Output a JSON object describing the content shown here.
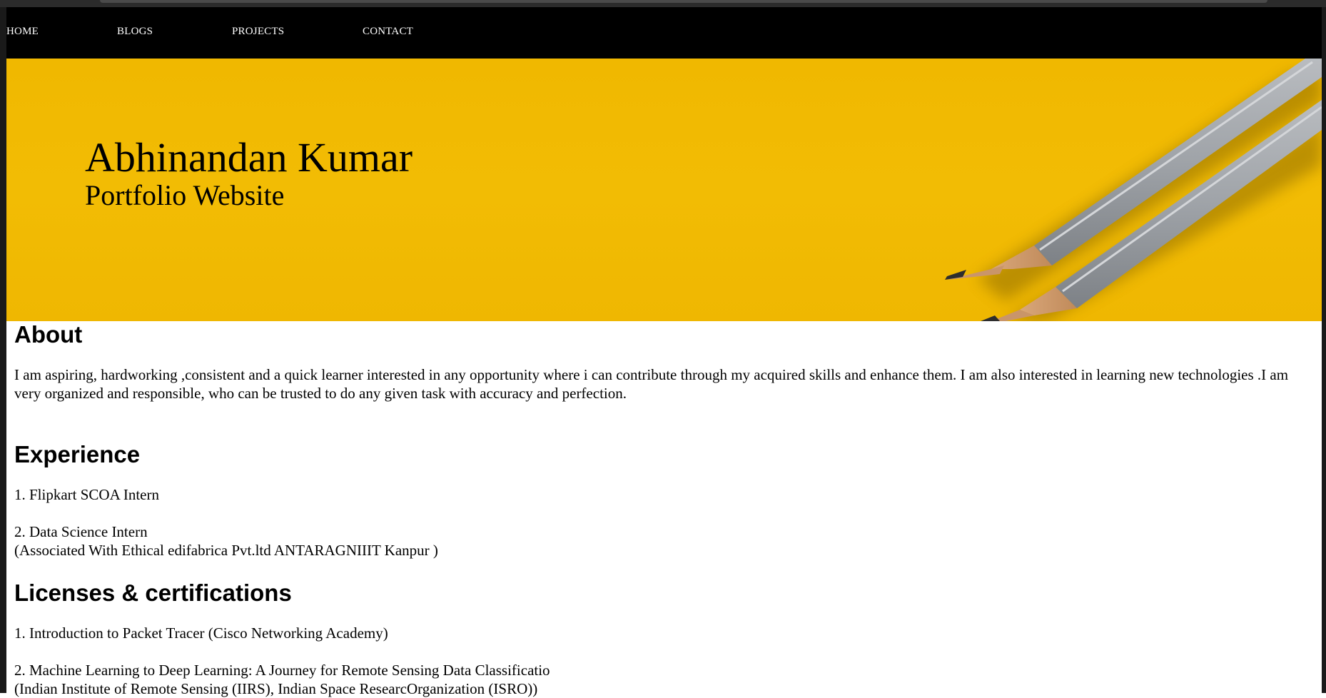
{
  "nav": {
    "items": [
      {
        "label": "HOME"
      },
      {
        "label": "BLOGS"
      },
      {
        "label": "PROJECTS"
      },
      {
        "label": "CONTACT"
      }
    ]
  },
  "hero": {
    "title": "Abhinandan Kumar",
    "subtitle": "Portfolio Website",
    "background_color": "#f2bc04"
  },
  "about": {
    "heading": "About",
    "text": "I am aspiring, hardworking ,consistent and a quick learner interested in any opportunity where i can contribute through my acquired skills and enhance them. I am also interested in learning new technologies .I am very organized and responsible, who can be trusted to do any given task with accuracy and perfection."
  },
  "experience": {
    "heading": "Experience",
    "items": [
      {
        "line1": "1. Flipkart SCOA Intern"
      },
      {
        "line1": "2. Data Science Intern",
        "line2": "(Associated With Ethical edifabrica Pvt.ltd ANTARAGNIIIT Kanpur )"
      }
    ]
  },
  "certifications": {
    "heading": "Licenses & certifications",
    "items": [
      {
        "line1": "1. Introduction to Packet Tracer (Cisco Networking Academy)"
      },
      {
        "line1": "2. Machine Learning to Deep Learning: A Journey for Remote Sensing Data Classificatio",
        "line2": "(Indian Institute of Remote Sensing (IIRS), Indian Space ResearcOrganization (ISRO))"
      }
    ]
  }
}
